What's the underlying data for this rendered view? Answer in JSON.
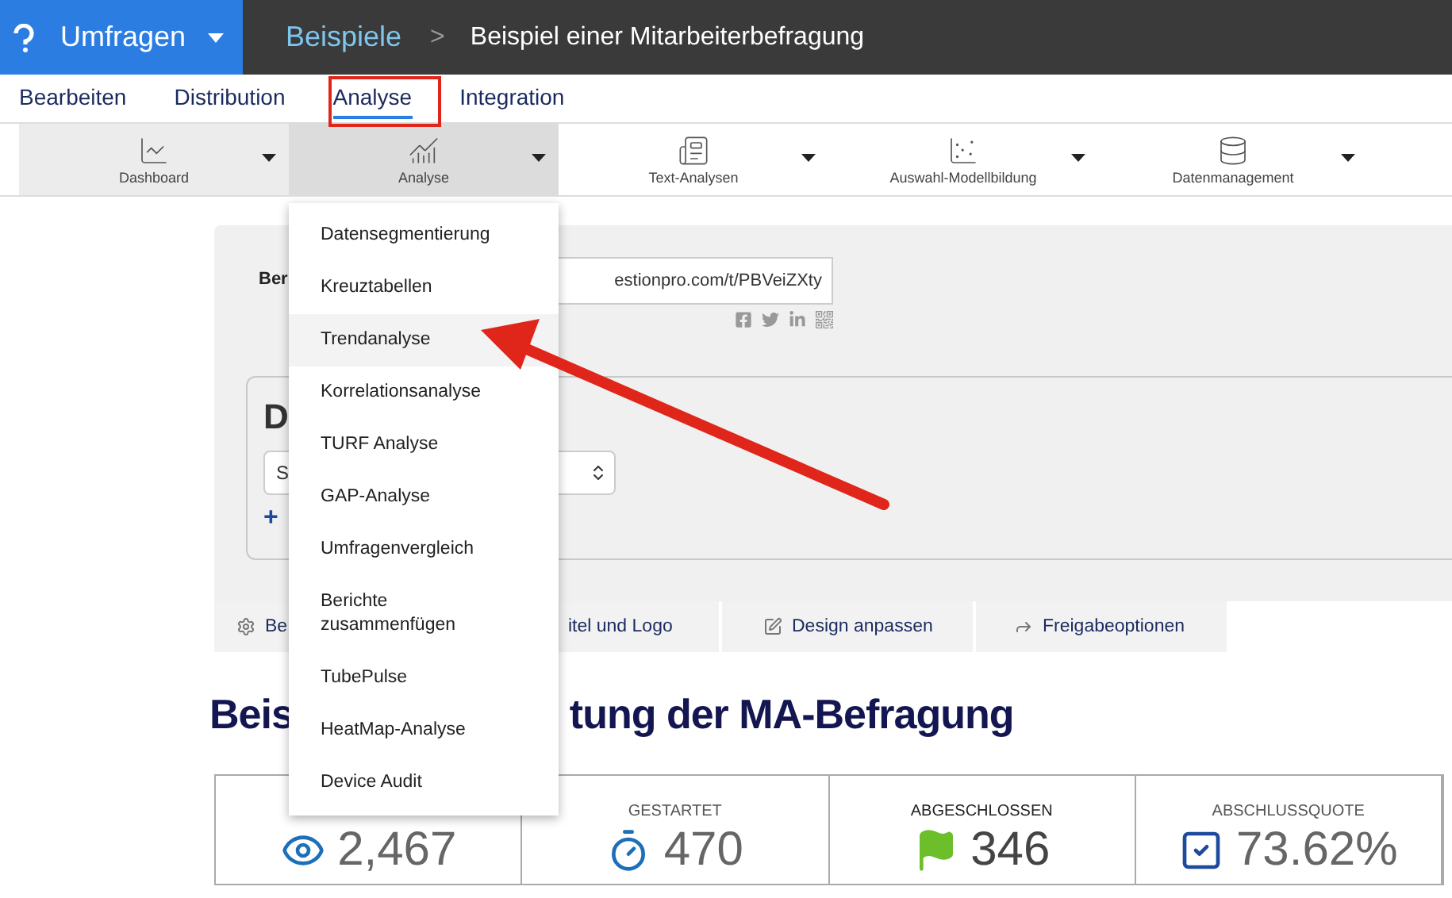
{
  "topbar": {
    "product": "Umfragen",
    "breadcrumb": "Beispiele",
    "separator": ">",
    "title": "Beispiel einer Mitarbeiterbefragung"
  },
  "tabs": [
    {
      "label": "Bearbeiten",
      "selected": false
    },
    {
      "label": "Distribution",
      "selected": false
    },
    {
      "label": "Analyse",
      "selected": true
    },
    {
      "label": "Integration",
      "selected": false
    }
  ],
  "toolbar": [
    {
      "label": "Dashboard",
      "kind": "line",
      "selected": false,
      "hovered": true
    },
    {
      "label": "Analyse",
      "kind": "trend",
      "selected": true,
      "hovered": false
    },
    {
      "label": "Text-Analysen",
      "kind": "document",
      "selected": false,
      "hovered": false
    },
    {
      "label": "Auswahl-Modellbildung",
      "kind": "scatter",
      "selected": false,
      "hovered": false
    },
    {
      "label": "Datenmanagement",
      "kind": "database",
      "selected": false,
      "hovered": false
    }
  ],
  "share": {
    "label": "Ber",
    "link": "estionpro.com/t/PBVeiZXty"
  },
  "dashboard_panel": {
    "heading": "D",
    "select_value": "S",
    "add_link": "+"
  },
  "actions": [
    {
      "label": "Be",
      "kind": "settings"
    },
    {
      "label": "itel und Logo",
      "kind": "partial"
    },
    {
      "label": "Design anpassen",
      "kind": "edit"
    },
    {
      "label": "Freigabeoptionen",
      "kind": "share"
    }
  ],
  "report_title": [
    "Beis",
    "tung der MA-Befragung"
  ],
  "stats": [
    {
      "kind": "views",
      "value": "2,467"
    },
    {
      "kind": "started",
      "label": "GESTARTET",
      "value": "470"
    },
    {
      "kind": "completed",
      "label": "ABGESCHLOSSEN",
      "value": "346"
    },
    {
      "kind": "rate",
      "label": "ABSCHLUSSQUOTE",
      "value": "73.62%"
    }
  ],
  "menu": [
    {
      "label": "Datensegmentierung",
      "selected": false
    },
    {
      "label": "Kreuztabellen",
      "selected": false
    },
    {
      "label": "Trendanalyse",
      "selected": true
    },
    {
      "label": "Korrelationsanalyse",
      "selected": false
    },
    {
      "label": "TURF Analyse",
      "selected": false
    },
    {
      "label": "GAP-Analyse",
      "selected": false
    },
    {
      "label": "Umfragenvergleich",
      "selected": false
    },
    {
      "label": "Berichte zusammenfügen",
      "selected": false
    },
    {
      "label": "TubePulse",
      "selected": false
    },
    {
      "label": "HeatMap-Analyse",
      "selected": false
    },
    {
      "label": "Device Audit",
      "selected": false
    }
  ]
}
